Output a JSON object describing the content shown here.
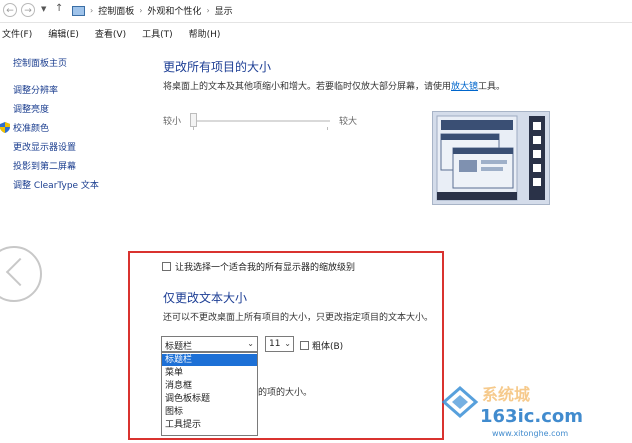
{
  "breadcrumb": [
    "控制面板",
    "外观和个性化",
    "显示"
  ],
  "menu": [
    "文件(F)",
    "编辑(E)",
    "查看(V)",
    "工具(T)",
    "帮助(H)"
  ],
  "sidebar": {
    "home": "控制面板主页",
    "items": [
      "调整分辨率",
      "调整亮度",
      "校准颜色",
      "更改显示器设置",
      "投影到第二屏幕",
      "调整 ClearType 文本"
    ]
  },
  "main": {
    "title": "更改所有项目的大小",
    "desc_before": "将桌面上的文本及其他项缩小和增大。若要临时仅放大部分屏幕，请使用",
    "desc_link": "放大镜",
    "desc_after": "工具。",
    "slider_small": "较小",
    "slider_large": "较大"
  },
  "custom": {
    "checkbox_label": "让我选择一个适合我的所有显示器的缩放级别",
    "title": "仅更改文本大小",
    "desc": "还可以不更改桌面上所有项目的大小，只更改指定项目的文本大小。",
    "item_combo_value": "标题栏",
    "size_combo_value": "11",
    "bold_label": "粗体(B)",
    "dropdown_options": [
      "标题栏",
      "菜单",
      "消息框",
      "调色板标题",
      "图标",
      "工具提示"
    ],
    "hidden_text_tail": "的项的大小。"
  },
  "watermark": {
    "text_top": "系统城",
    "url": "163ic.com",
    "site": "www.xitonghe.com"
  },
  "colors": {
    "link": "#1a3d8f",
    "title": "#1e3f95",
    "highlight_frame": "#d9322f",
    "selection": "#1d70d6"
  }
}
